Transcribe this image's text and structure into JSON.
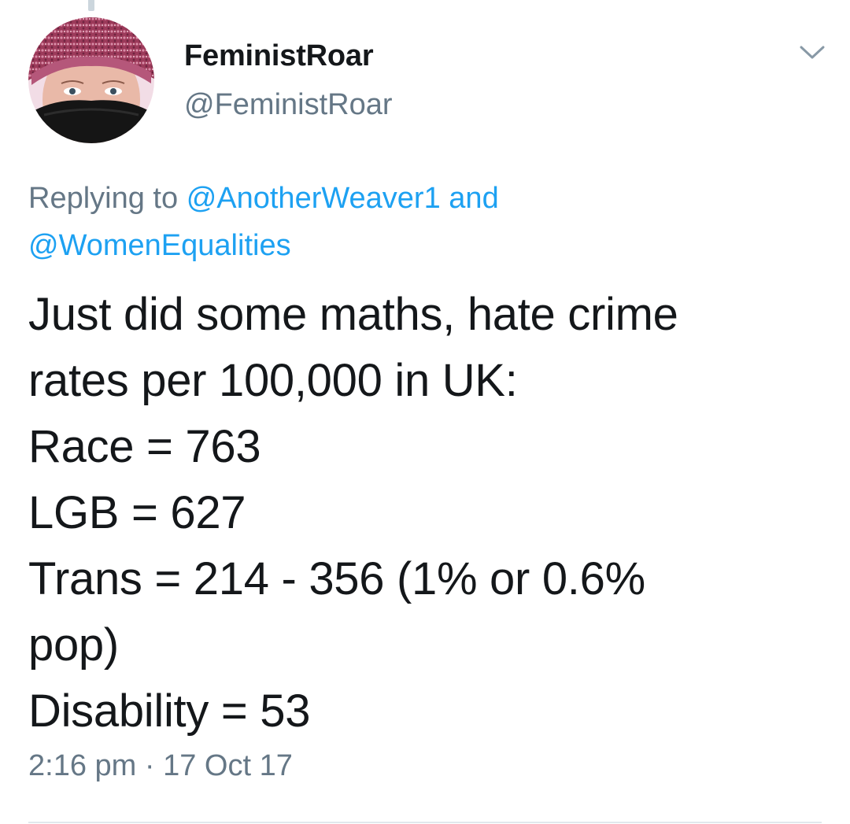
{
  "author": {
    "display_name": "FeministRoar",
    "handle": "@FeministRoar",
    "avatar_icon": "profile-photo"
  },
  "menu": {
    "icon": "chevron-down-icon"
  },
  "reply_context": {
    "prefix": "Replying to",
    "mention_1": "@AnotherWeaver1",
    "joiner": "and",
    "mention_2": "@WomenEqualities"
  },
  "tweet": {
    "lines": [
      "Just did some maths, hate crime",
      "rates per 100,000 in UK:",
      "Race = 763",
      "LGB = 627",
      "Trans = 214 - 356 (1% or 0.6%",
      "pop)",
      "Disability = 53"
    ]
  },
  "meta": {
    "time": "2:16 pm",
    "separator": "·",
    "date": "17 Oct 17"
  },
  "colors": {
    "text": "#14171a",
    "secondary": "#657786",
    "link": "#1da1f2",
    "divider": "#e1e8ed"
  }
}
